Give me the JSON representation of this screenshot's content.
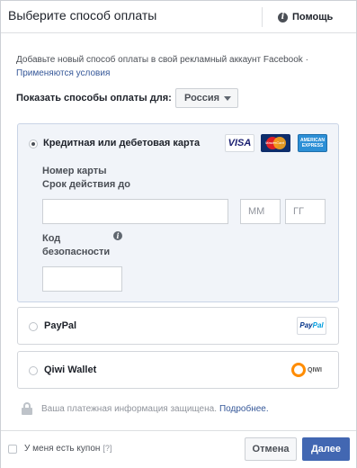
{
  "header": {
    "title": "Выберите способ оплаты",
    "help_label": "Помощь",
    "help_icon": "info-icon"
  },
  "intro": {
    "text": "Добавьте новый способ оплаты в свой рекламный аккаунт Facebook ·",
    "terms_link": "Применяются условия"
  },
  "country": {
    "label": "Показать способы оплаты для:",
    "selected": "Россия"
  },
  "card_method": {
    "label": "Кредитная или дебетовая карта",
    "selected": true,
    "logos": [
      "visa",
      "mastercard",
      "american-express"
    ],
    "visa_text": "VISA",
    "mastercard_text": "MasterCard",
    "amex_text": "AMERICAN EXPRESS",
    "card_number_label": "Номер карты",
    "expiry_label": "Срок действия до",
    "month_placeholder": "ММ",
    "year_placeholder": "ГГ",
    "cvv_label_line1": "Код",
    "cvv_label_line2": "безопасности"
  },
  "paypal_method": {
    "label": "PayPal",
    "logo_text_1": "Pay",
    "logo_text_2": "Pal"
  },
  "qiwi_method": {
    "label": "Qiwi Wallet",
    "logo_text": "QIWI"
  },
  "secure": {
    "text": "Ваша платежная информация защищена.",
    "link": "Подробнее."
  },
  "footer": {
    "coupon_label": "У меня есть купон",
    "coupon_help": "[?]",
    "cancel_label": "Отмена",
    "next_label": "Далее"
  },
  "colors": {
    "primary": "#4267b2",
    "link": "#365899",
    "card_box_bg": "#f1f4f9"
  }
}
